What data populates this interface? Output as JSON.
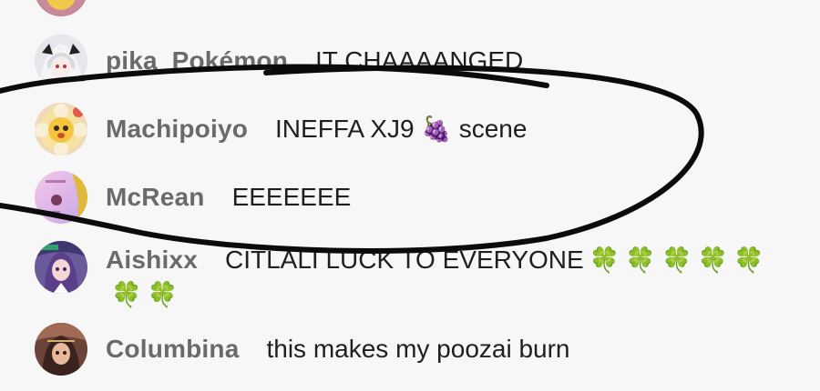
{
  "colors": {
    "background": "#f7f7f7",
    "username": "#6a6a6a",
    "message_text": "#1f1f1f",
    "ink_circle": "#0b0b0b",
    "clover": "#2f9e3a",
    "grapes": "#8b2456"
  },
  "messages": [
    {
      "username": "pika_Pokémon",
      "text": "IT CHAAAANGED",
      "avatar_icon": "anime-girl-white-hair-avatar-icon"
    },
    {
      "username": "Machipoiyo",
      "text_before": "INEFFA XJ9",
      "emoji": "🍇",
      "emoji_icon": "grapes-icon",
      "text_after": "scene",
      "avatar_icon": "flower-face-avatar-icon"
    },
    {
      "username": "McRean",
      "text": "EEEEEEE",
      "avatar_icon": "pink-sticker-avatar-icon"
    },
    {
      "username": "Aishixx",
      "text": "CITLALI LUCK TO EVERYONE",
      "emoji": "🍀",
      "emoji_icon": "four-leaf-clover-icon",
      "emoji_count": 7,
      "avatar_icon": "purple-hair-character-avatar-icon"
    },
    {
      "username": "Columbina",
      "text": "this makes my poozai burn",
      "avatar_icon": "dark-hair-character-avatar-icon"
    }
  ]
}
